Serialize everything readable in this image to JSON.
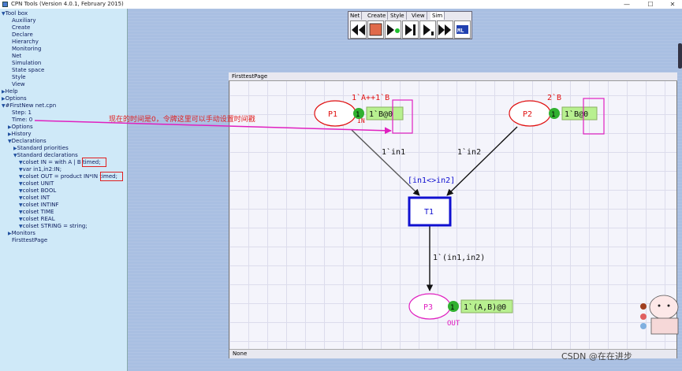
{
  "window": {
    "title": "CPN Tools (Version 4.0.1, February 2015)",
    "minimize": "—",
    "maximize": "☐",
    "close": "✕"
  },
  "index": {
    "toolbox": "Tool box",
    "tool_items": [
      "Auxiliary",
      "Create",
      "Declare",
      "Hierarchy",
      "Monitoring",
      "Net",
      "Simulation",
      "State space",
      "Style",
      "View"
    ],
    "help": "Help",
    "options": "Options",
    "net_file": "#FirstNew net.cpn",
    "step": "Step: 1",
    "time": "Time: 0",
    "net_options": "Options",
    "history": "History",
    "declarations": "Declarations",
    "std_priorities": "Standard priorities",
    "std_declarations": "Standard declarations",
    "decls": [
      "colset IN = with A | B timed;",
      "var in1,in2:IN;",
      "colset OUT = product IN*IN timed;",
      "colset UNIT",
      "colset BOOL",
      "colset INT",
      "colset INTINF",
      "colset TIME",
      "colset REAL",
      "colset STRING = string;"
    ],
    "monitors": "Monitors",
    "page": "FirsttestPage"
  },
  "toolbox": {
    "tabs": [
      "Net",
      "Create",
      "Style",
      "View",
      "Sim"
    ],
    "active_tab": "Sim"
  },
  "page": {
    "tab_label": "FirsttestPage",
    "footer": "None",
    "places": [
      {
        "name": "P1",
        "init_marking": "1`A++1`B",
        "count": "1",
        "marking": "1`B@0",
        "port": "IN"
      },
      {
        "name": "P2",
        "init_marking": "2`B",
        "count": "1",
        "marking": "1`B@0",
        "port": ""
      },
      {
        "name": "P3",
        "init_marking": "",
        "count": "1",
        "marking": "1`(A,B)@0",
        "port": "OUT"
      }
    ],
    "transition": {
      "name": "T1",
      "guard": "[in1<>in2]"
    },
    "arcs": [
      "1`in1",
      "1`in2",
      "1`(in1,in2)"
    ]
  },
  "annotation": "现在的时间是0，令牌这里可以手动设置时间戳",
  "watermark": "CSDN @在在进步",
  "colors": {
    "place": "#e01010",
    "transition": "#1010d0",
    "marking_bg": "#b8f090",
    "token": "#30b030",
    "magenta": "#e020c0"
  }
}
